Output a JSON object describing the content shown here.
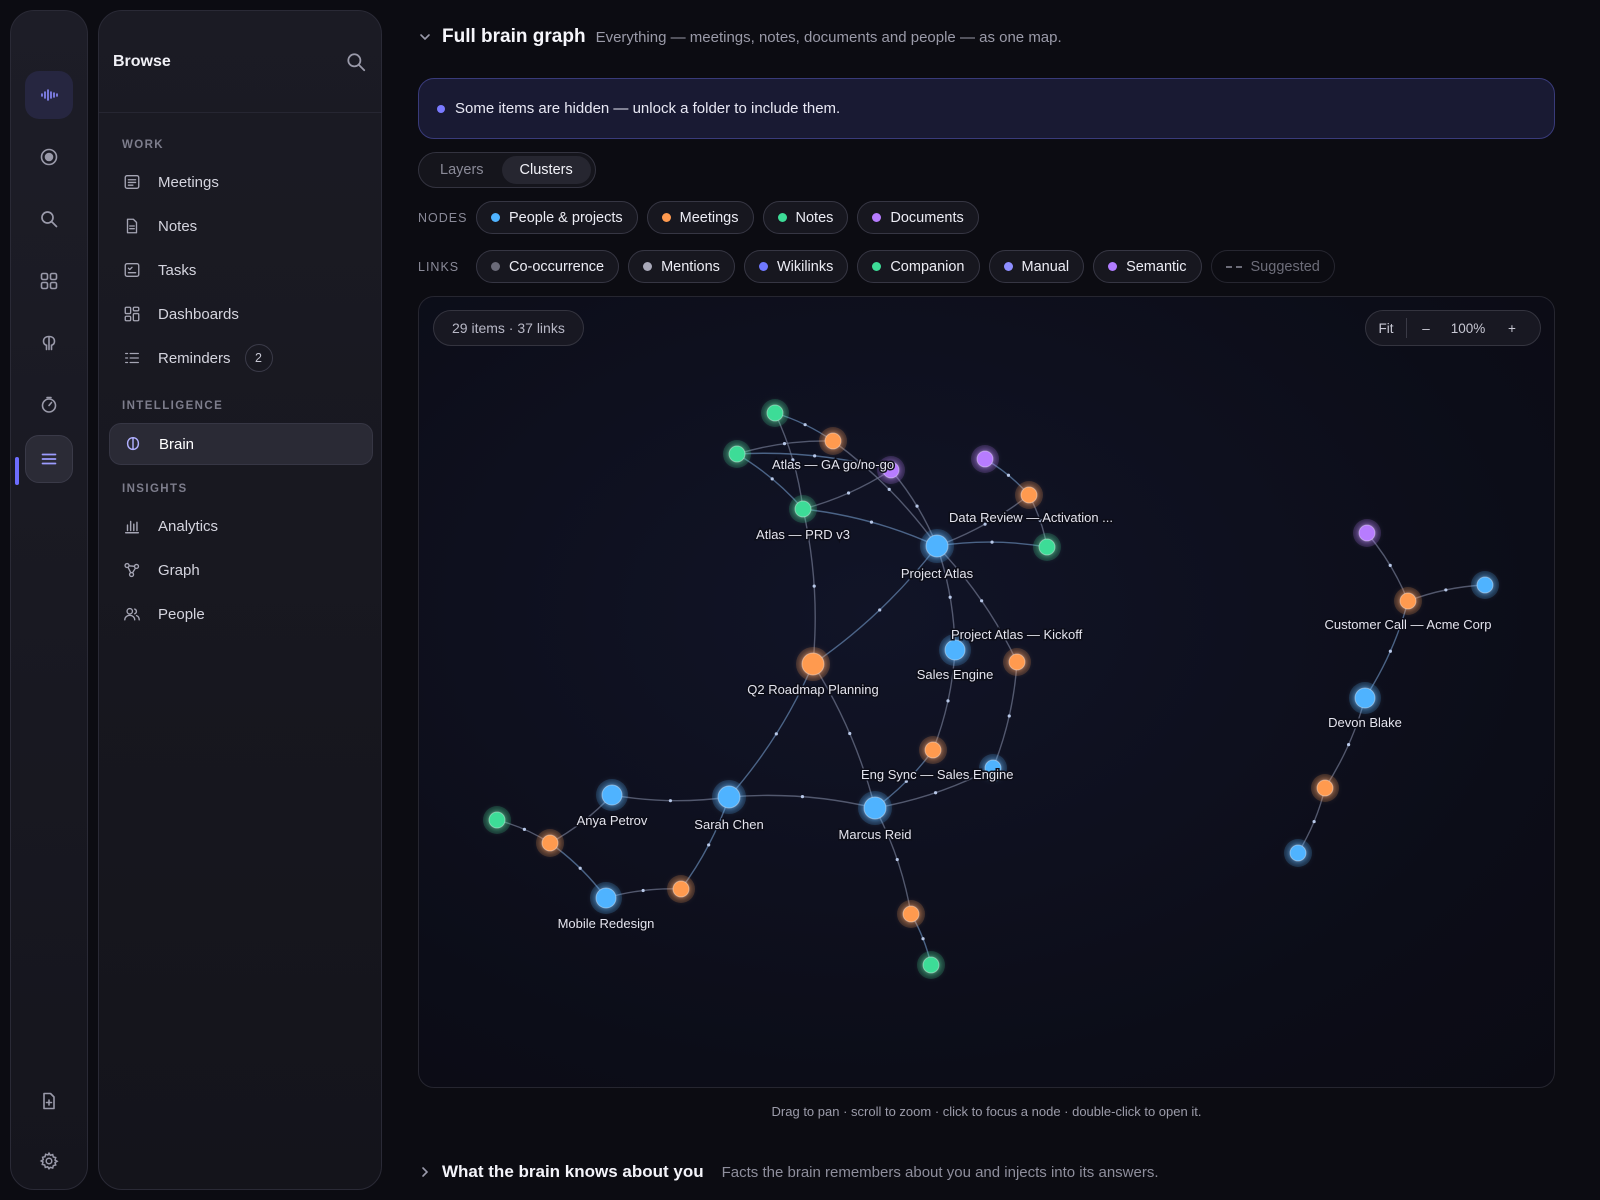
{
  "browse": {
    "title": "Browse",
    "sections": [
      {
        "label": "WORK"
      },
      {
        "label": "INTELLIGENCE"
      },
      {
        "label": "INSIGHTS"
      }
    ],
    "items": [
      {
        "label": "Meetings",
        "icon": "meetings-icon"
      },
      {
        "label": "Notes",
        "icon": "notes-icon"
      },
      {
        "label": "Tasks",
        "icon": "tasks-icon"
      },
      {
        "label": "Dashboards",
        "icon": "dashboards-icon"
      },
      {
        "label": "Reminders",
        "icon": "reminders-icon",
        "badge": "2"
      },
      {
        "label": "Brain",
        "icon": "brain-icon",
        "active": true
      },
      {
        "label": "Analytics",
        "icon": "analytics-icon"
      },
      {
        "label": "Graph",
        "icon": "graph-icon"
      },
      {
        "label": "People",
        "icon": "people-icon"
      }
    ]
  },
  "main": {
    "title": "Full brain graph",
    "subtitle": "Everything — meetings, notes, documents and people — as one map.",
    "notice": "Some items are hidden — unlock a folder to include them.",
    "view_tabs": [
      {
        "label": "Layers",
        "active": false
      },
      {
        "label": "Clusters",
        "active": true
      }
    ],
    "nodes_label": "NODES",
    "node_filters": [
      {
        "label": "People & projects",
        "color": "#4fb3ff"
      },
      {
        "label": "Meetings",
        "color": "#ff9a4f"
      },
      {
        "label": "Notes",
        "color": "#3ddc97"
      },
      {
        "label": "Documents",
        "color": "#b77cff"
      }
    ],
    "links_label": "LINKS",
    "link_filters": [
      {
        "label": "Co-occurrence",
        "color": "#6a6a78"
      },
      {
        "label": "Mentions",
        "color": "#a8a8b8"
      },
      {
        "label": "Wikilinks",
        "color": "#6f78ff"
      },
      {
        "label": "Companion",
        "color": "#3ddc97"
      },
      {
        "label": "Manual",
        "color": "#8e8eff"
      },
      {
        "label": "Semantic",
        "color": "#b07cff"
      },
      {
        "label": "Suggested",
        "color": "#6c6c78",
        "dashed": true
      }
    ],
    "count": "29 items · 37 links",
    "zoom": {
      "fit": "Fit",
      "minus": "–",
      "level": "100%",
      "plus": "+"
    },
    "hint": "Drag to pan · scroll to zoom · click to focus a node · double-click to open it.",
    "knows_title": "What the brain knows about you",
    "knows_subtitle": "Facts the brain remembers about you and injects into its answers."
  },
  "graph": {
    "colors": {
      "person": "#4fb3ff",
      "meeting": "#ff9a4f",
      "note": "#3ddc97",
      "document": "#b77cff"
    },
    "nodes": [
      {
        "id": "n1",
        "type": "note"
      },
      {
        "id": "ga",
        "type": "meeting",
        "label": "Atlas — GA go/no-go"
      },
      {
        "id": "n2",
        "type": "note"
      },
      {
        "id": "d1",
        "type": "document"
      },
      {
        "id": "prd",
        "type": "note",
        "label": "Atlas — PRD v3"
      },
      {
        "id": "atlas",
        "type": "person",
        "label": "Project Atlas",
        "big": true
      },
      {
        "id": "d2",
        "type": "document"
      },
      {
        "id": "dr",
        "type": "meeting",
        "label": "Data Review — Activation ..."
      },
      {
        "id": "n3",
        "type": "note"
      },
      {
        "id": "sales",
        "type": "person",
        "label": "Sales Engine"
      },
      {
        "id": "kick",
        "type": "meeting",
        "label": "Project Atlas — Kickoff"
      },
      {
        "id": "q2",
        "type": "meeting",
        "label": "Q2 Roadmap Planning",
        "big": true
      },
      {
        "id": "eng",
        "type": "meeting",
        "label": "Eng Sync — Sales Engine"
      },
      {
        "id": "p1",
        "type": "person"
      },
      {
        "id": "marcus",
        "type": "person",
        "label": "Marcus Reid",
        "big": true
      },
      {
        "id": "sarah",
        "type": "person",
        "label": "Sarah Chen",
        "big": true
      },
      {
        "id": "anya",
        "type": "person",
        "label": "Anya Petrov"
      },
      {
        "id": "n4",
        "type": "note"
      },
      {
        "id": "m1",
        "type": "meeting"
      },
      {
        "id": "mobile",
        "type": "person",
        "label": "Mobile Redesign"
      },
      {
        "id": "m2",
        "type": "meeting"
      },
      {
        "id": "m3",
        "type": "meeting"
      },
      {
        "id": "n5",
        "type": "note"
      },
      {
        "id": "d3",
        "type": "document"
      },
      {
        "id": "cc",
        "type": "meeting",
        "label": "Customer Call — Acme Corp"
      },
      {
        "id": "p2",
        "type": "person"
      },
      {
        "id": "devon",
        "type": "person",
        "label": "Devon Blake"
      },
      {
        "id": "m4",
        "type": "meeting"
      },
      {
        "id": "p3",
        "type": "person"
      }
    ],
    "links": [
      [
        "n1",
        "ga"
      ],
      [
        "n1",
        "prd"
      ],
      [
        "n2",
        "ga"
      ],
      [
        "n2",
        "prd"
      ],
      [
        "ga",
        "atlas"
      ],
      [
        "d1",
        "atlas"
      ],
      [
        "prd",
        "atlas"
      ],
      [
        "prd",
        "q2"
      ],
      [
        "d1",
        "prd"
      ],
      [
        "d2",
        "dr"
      ],
      [
        "dr",
        "atlas"
      ],
      [
        "dr",
        "n3"
      ],
      [
        "atlas",
        "n3"
      ],
      [
        "atlas",
        "sales"
      ],
      [
        "atlas",
        "kick"
      ],
      [
        "atlas",
        "q2"
      ],
      [
        "sales",
        "eng"
      ],
      [
        "kick",
        "p1"
      ],
      [
        "eng",
        "marcus"
      ],
      [
        "p1",
        "marcus"
      ],
      [
        "q2",
        "marcus"
      ],
      [
        "q2",
        "sarah"
      ],
      [
        "sarah",
        "anya"
      ],
      [
        "sarah",
        "marcus"
      ],
      [
        "sarah",
        "m2"
      ],
      [
        "anya",
        "m1"
      ],
      [
        "n4",
        "m1"
      ],
      [
        "m1",
        "mobile"
      ],
      [
        "mobile",
        "m2"
      ],
      [
        "marcus",
        "m3"
      ],
      [
        "m3",
        "n5"
      ],
      [
        "d3",
        "cc"
      ],
      [
        "cc",
        "p2"
      ],
      [
        "cc",
        "devon"
      ],
      [
        "devon",
        "m4"
      ],
      [
        "m4",
        "p3"
      ],
      [
        "n2",
        "d1"
      ]
    ]
  }
}
